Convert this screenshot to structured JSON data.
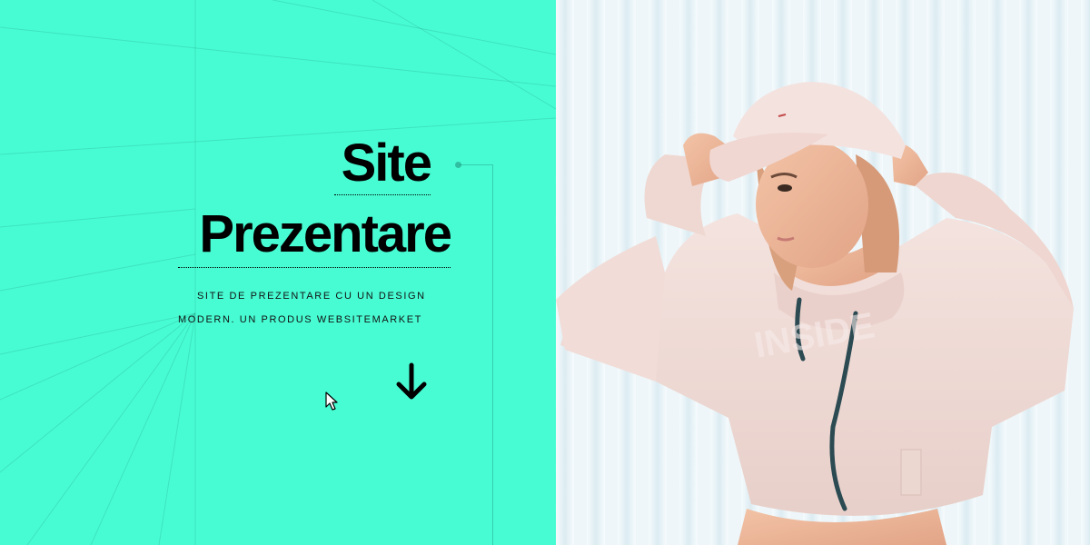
{
  "hero": {
    "title_line1": "Site",
    "title_line2": "Prezentare",
    "subtitle_line1": "SITE DE PREZENTARE CU UN DESIGN",
    "subtitle_line2": "MODERN. UN PRODUS WEBSITEMARKET",
    "scroll_icon": "arrow-down-icon"
  },
  "photo": {
    "subject": "woman-in-cap-and-hoodie"
  },
  "colors": {
    "accent": "#47fcd3",
    "text": "#000000",
    "photo_bg": "#e8f3f7"
  }
}
